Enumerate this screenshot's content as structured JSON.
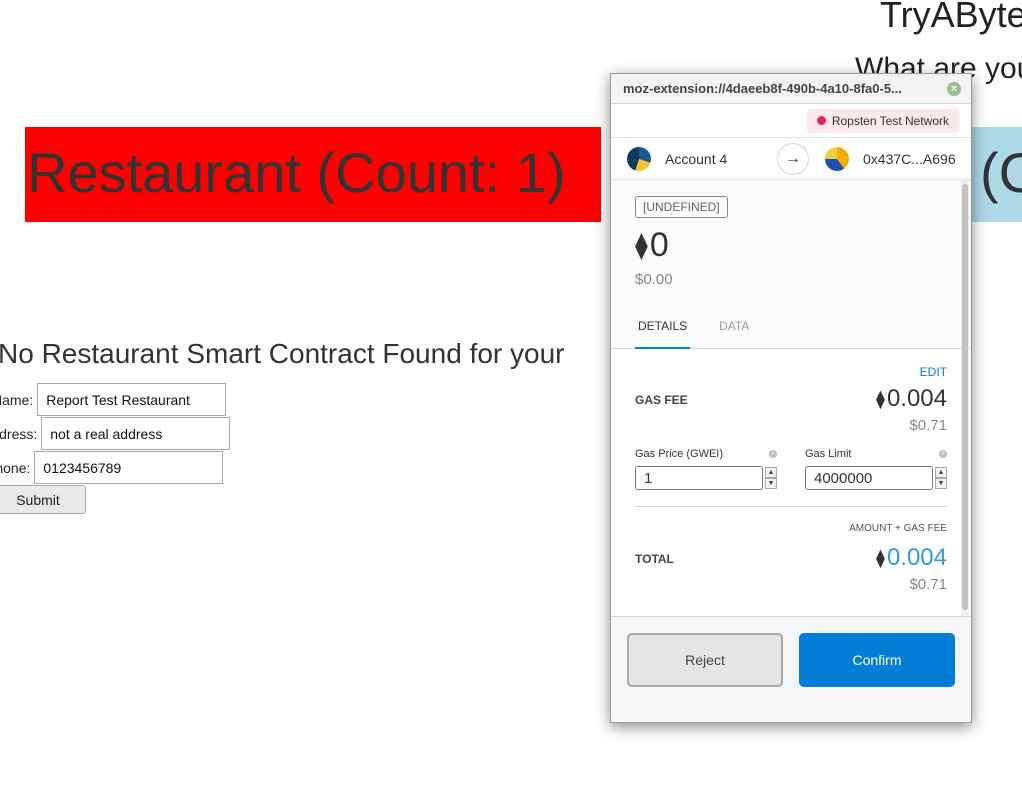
{
  "page": {
    "site_title": "TryAByte",
    "question": "What are you",
    "banner_red": "Restaurant (Count: 1)",
    "banner_blue": "(C",
    "no_contract_msg": "No Restaurant Smart Contract Found for your",
    "form": {
      "name_label": "Name:",
      "name_value": "Report Test Restaurant",
      "address_label": "Address:",
      "address_value": "not a real address",
      "phone_label": "Phone:",
      "phone_value": "0123456789",
      "submit_label": "Submit"
    }
  },
  "popup": {
    "url": "moz-extension://4daeeb8f-490b-4a10-8fa0-5...",
    "close_glyph": "×",
    "network": "Ropsten Test Network",
    "from_account": "Account 4",
    "to_address": "0x437C...A696",
    "arrow_glyph": "→",
    "tag": "[UNDEFINED]",
    "eth_glyph": "⧫",
    "amount": "0",
    "amount_usd": "$0.00",
    "tabs": [
      {
        "label": "DETAILS",
        "active": true
      },
      {
        "label": "DATA",
        "active": false
      }
    ],
    "edit_label": "EDIT",
    "gas_fee_label": "GAS FEE",
    "gas_fee_eth": "0.004",
    "gas_fee_usd": "$0.71",
    "gas_price_label": "Gas Price (GWEI)",
    "gas_price_value": "1",
    "gas_limit_label": "Gas Limit",
    "gas_limit_value": "4000000",
    "amount_gas_label": "AMOUNT + GAS FEE",
    "total_label": "TOTAL",
    "total_eth": "0.004",
    "total_usd": "$0.71",
    "reject_label": "Reject",
    "confirm_label": "Confirm"
  },
  "colors": {
    "banner_red": "#ff0000",
    "banner_blue": "#add8e6",
    "accent_blue": "#037dd6",
    "network_dot": "#e0245e"
  }
}
